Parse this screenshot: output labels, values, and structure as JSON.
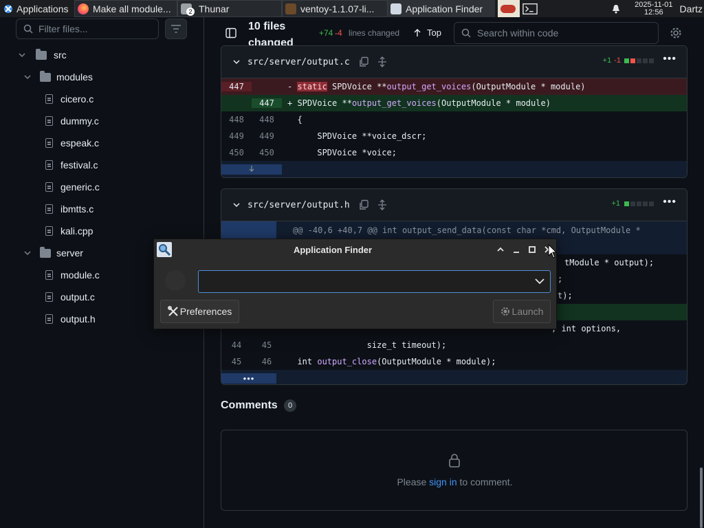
{
  "taskbar": {
    "apps_label": "Applications",
    "tasks": [
      {
        "label": "Make all module...",
        "icon": "firefox-icon"
      },
      {
        "label": "Thunar",
        "icon": "file-manager-icon",
        "badge": "2"
      },
      {
        "label": "ventoy-1.1.07-li...",
        "icon": "archive-icon"
      },
      {
        "label": "Application Finder",
        "icon": "search-app-icon"
      }
    ],
    "clock_date": "2025-11-01",
    "clock_time": "12:56",
    "user": "Dartz"
  },
  "sidebar": {
    "filter_placeholder": "Filter files...",
    "tree": [
      {
        "type": "folder",
        "label": "src",
        "level": 0
      },
      {
        "type": "folder",
        "label": "modules",
        "level": 1
      },
      {
        "type": "file",
        "label": "cicero.c",
        "level": 2
      },
      {
        "type": "file",
        "label": "dummy.c",
        "level": 2
      },
      {
        "type": "file",
        "label": "espeak.c",
        "level": 2
      },
      {
        "type": "file",
        "label": "festival.c",
        "level": 2
      },
      {
        "type": "file",
        "label": "generic.c",
        "level": 2
      },
      {
        "type": "file",
        "label": "ibmtts.c",
        "level": 2
      },
      {
        "type": "file",
        "label": "kali.cpp",
        "level": 2
      },
      {
        "type": "folder",
        "label": "server",
        "level": 1
      },
      {
        "type": "file",
        "label": "module.c",
        "level": 2
      },
      {
        "type": "file",
        "label": "output.c",
        "level": 2
      },
      {
        "type": "file",
        "label": "output.h",
        "level": 2
      }
    ]
  },
  "header": {
    "files_changed": "10 files changed",
    "additions": "+74",
    "deletions": "-4",
    "lines_changed_label": "lines changed",
    "top_label": "Top",
    "search_placeholder": "Search within code"
  },
  "diff1": {
    "filename": "src/server/output.c",
    "stat_add": "+1",
    "stat_del": "-1",
    "rows": [
      {
        "kind": "del",
        "old": "447",
        "new": "",
        "prefix": "-",
        "kw": "static",
        "pre": " SPDVoice **",
        "fn": "output_get_voices",
        "rest": "(OutputModule * module)"
      },
      {
        "kind": "add",
        "old": "",
        "new": "447",
        "prefix": "+",
        "kw": "",
        "pre": " SPDVoice **",
        "fn": "output_get_voices",
        "rest": "(OutputModule * module)"
      },
      {
        "kind": "ctx",
        "old": "448",
        "new": "448",
        "text": "  {"
      },
      {
        "kind": "ctx",
        "old": "449",
        "new": "449",
        "text": "      SPDVoice **voice_dscr;"
      },
      {
        "kind": "ctx",
        "old": "450",
        "new": "450",
        "text": "      SPDVoice *voice;"
      }
    ]
  },
  "diff2": {
    "filename": "src/server/output.h",
    "stat_add": "+1",
    "hunk": "@@ -40,6 +40,7 @@ int output_send_data(const char *cmd, OutputModule *",
    "partial_lines": [
      "tModule * output);",
      ";",
      "t);"
    ],
    "partial_line4": ", int options,",
    "rows": [
      {
        "old": "44",
        "new": "45",
        "text": "                size_t timeout);"
      },
      {
        "old": "45",
        "new": "46",
        "pre": "  int ",
        "fn": "output_close",
        "rest": "(OutputModule * module);"
      }
    ]
  },
  "comments": {
    "title": "Comments",
    "count": "0",
    "prompt_pre": "Please ",
    "prompt_link": "sign in",
    "prompt_post": " to comment."
  },
  "dialog": {
    "title": "Application Finder",
    "preferences_label": "Preferences",
    "launch_label": "Launch",
    "combo_value": ""
  },
  "colors": {
    "bg": "#0d1117",
    "add": "#3fb950",
    "del": "#f85149",
    "link": "#4493f8"
  }
}
